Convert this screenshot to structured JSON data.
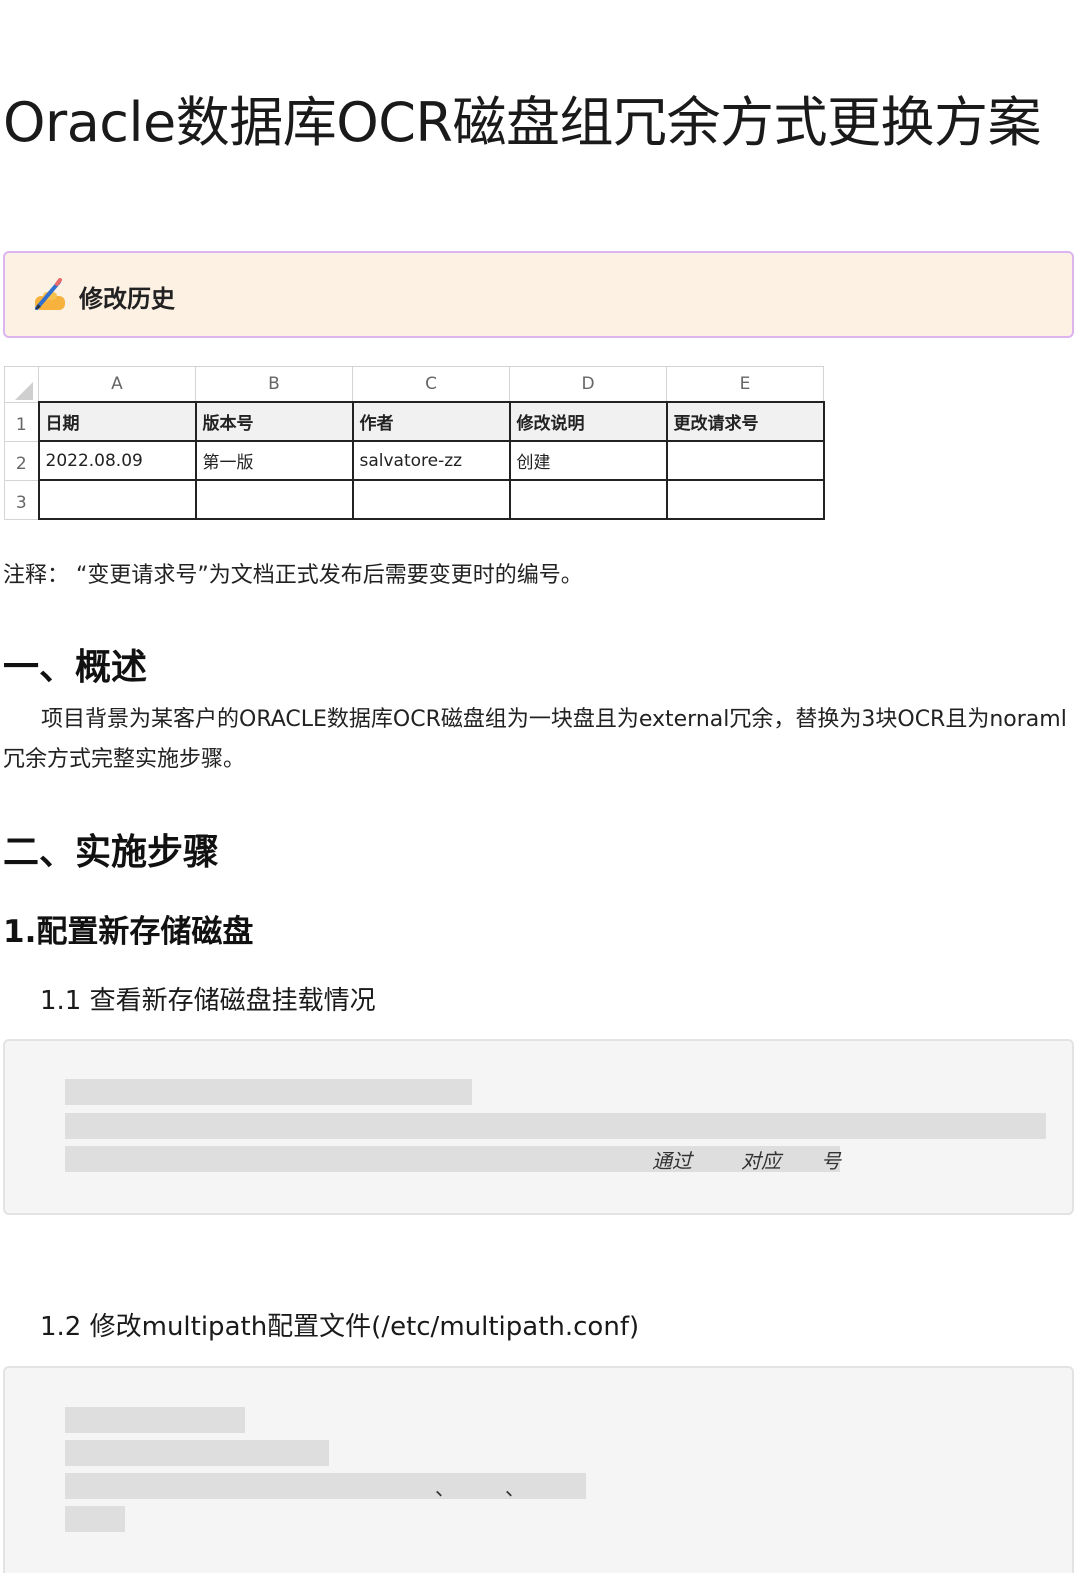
{
  "document": {
    "title": "Oracle数据库OCR磁盘组冗余方式更换方案",
    "callout": {
      "icon": "writing-hand-icon",
      "text": "修改历史"
    },
    "table": {
      "column_headers": [
        "A",
        "B",
        "C",
        "D",
        "E"
      ],
      "row_numbers": [
        "1",
        "2",
        "3"
      ],
      "rows": [
        [
          "日期",
          "版本号",
          "作者",
          "修改说明",
          "更改请求号"
        ],
        [
          "2022.08.09",
          "第一版",
          "salvatore-zz",
          "创建",
          ""
        ],
        [
          "",
          "",
          "",
          "",
          ""
        ]
      ]
    },
    "note": "注释：  “变更请求号”为文档正式发布后需要变更时的编号。",
    "section1": {
      "heading": "一、概述",
      "paragraph": "项目背景为某客户的ORACLE数据库OCR磁盘组为一块盘且为external冗余，替换为3块OCR且为noraml冗余方式完整实施步骤。"
    },
    "section2": {
      "heading": "二、实施步骤",
      "sub1": {
        "heading": "1.配置新存储磁盘",
        "step1": {
          "heading": "1.1 查看新存储磁盘挂载情况",
          "code_fragments": [
            "通过",
            "对应",
            "号"
          ]
        },
        "step2": {
          "heading": "1.2 修改multipath配置文件(/etc/multipath.conf)",
          "code_fragments": [
            "、",
            "、"
          ]
        }
      }
    },
    "colors": {
      "callout_bg": "#fdf1e4",
      "callout_border": "#dcb4f0",
      "code_bg": "#f5f5f6",
      "redacted_bar": "#dedede"
    }
  }
}
